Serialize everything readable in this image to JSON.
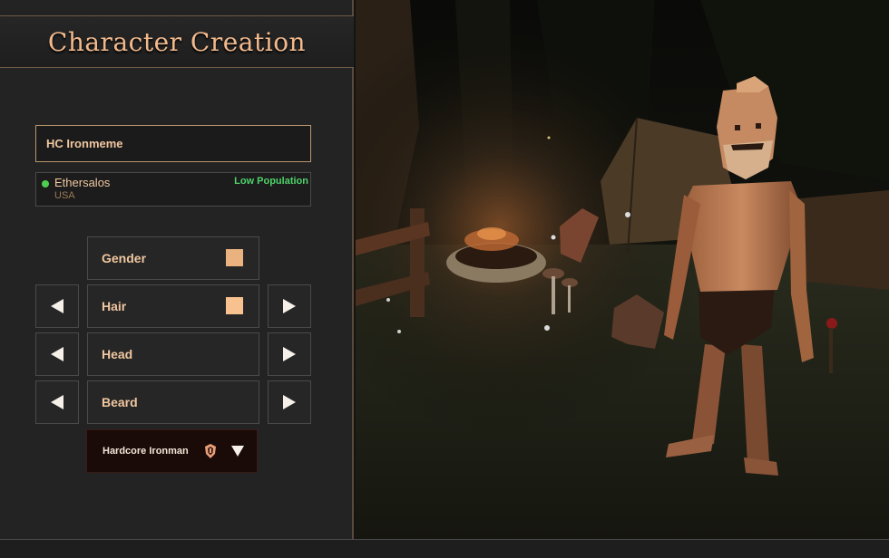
{
  "window": {
    "title": "Character Creation"
  },
  "name_field": {
    "value": "HC Ironmeme"
  },
  "server": {
    "name": "Ethersalos",
    "region": "USA",
    "population": "Low Population",
    "status_color": "#4fcf4f",
    "population_color": "#4fd26a"
  },
  "options": {
    "gender": {
      "label": "Gender",
      "swatch_color": "#e9b27e"
    },
    "hair": {
      "label": "Hair",
      "swatch_color": "#f7c28f"
    },
    "head": {
      "label": "Head"
    },
    "beard": {
      "label": "Beard"
    }
  },
  "mode_select": {
    "label": "Hardcore Ironman",
    "icon": "ironman-helmet-icon"
  },
  "colors": {
    "accent": "#f2b98c",
    "text": "#f0c7a0",
    "panel": "#232323",
    "border": "#b9966d"
  }
}
